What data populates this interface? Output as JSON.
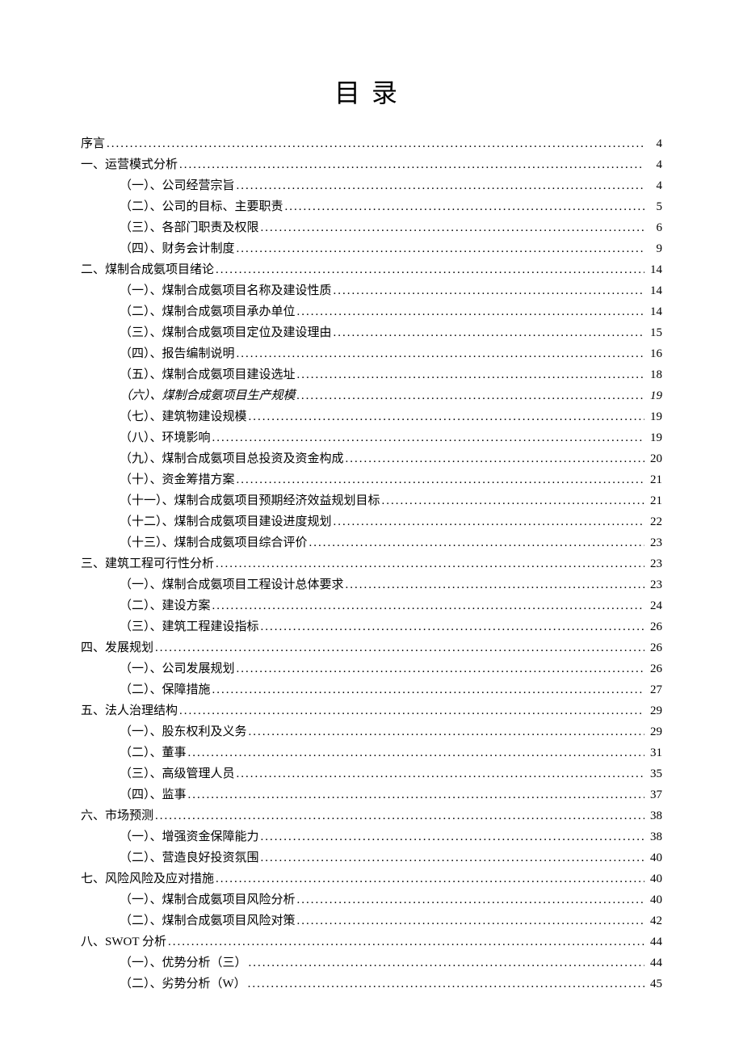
{
  "title": "目录",
  "entries": [
    {
      "level": 0,
      "text": "序言",
      "page": "4",
      "italic": false
    },
    {
      "level": 0,
      "text": "一、运营模式分析",
      "page": "4",
      "italic": false
    },
    {
      "level": 1,
      "text": "（一）、公司经营宗旨",
      "page": "4",
      "italic": false
    },
    {
      "level": 1,
      "text": "（二）、公司的目标、主要职责",
      "page": "5",
      "italic": false
    },
    {
      "level": 1,
      "text": "（三）、各部门职责及权限",
      "page": "6",
      "italic": false
    },
    {
      "level": 1,
      "text": "（四）、财务会计制度",
      "page": "9",
      "italic": false
    },
    {
      "level": 0,
      "text": "二、煤制合成氨项目绪论",
      "page": "14",
      "italic": false
    },
    {
      "level": 1,
      "text": "（一）、煤制合成氨项目名称及建设性质",
      "page": "14",
      "italic": false
    },
    {
      "level": 1,
      "text": "（二）、煤制合成氨项目承办单位",
      "page": "14",
      "italic": false
    },
    {
      "level": 1,
      "text": "（三）、煤制合成氨项目定位及建设理由",
      "page": "15",
      "italic": false
    },
    {
      "level": 1,
      "text": "（四）、报告编制说明",
      "page": "16",
      "italic": false
    },
    {
      "level": 1,
      "text": "（五）、煤制合成氨项目建设选址",
      "page": "18",
      "italic": false
    },
    {
      "level": 1,
      "text": "（六）、煤制合成氨项目生产规模",
      "page": "19",
      "italic": true
    },
    {
      "level": 1,
      "text": "（七）、建筑物建设规模",
      "page": "19",
      "italic": false
    },
    {
      "level": 1,
      "text": "（八）、环境影响",
      "page": "19",
      "italic": false
    },
    {
      "level": 1,
      "text": "（九）、煤制合成氨项目总投资及资金构成",
      "page": "20",
      "italic": false
    },
    {
      "level": 1,
      "text": "（十）、资金筹措方案",
      "page": "21",
      "italic": false
    },
    {
      "level": 1,
      "text": "（十一）、煤制合成氨项目预期经济效益规划目标",
      "page": "21",
      "italic": false
    },
    {
      "level": 1,
      "text": "（十二）、煤制合成氨项目建设进度规划",
      "page": "22",
      "italic": false
    },
    {
      "level": 1,
      "text": "（十三）、煤制合成氨项目综合评价",
      "page": "23",
      "italic": false
    },
    {
      "level": 0,
      "text": "三、建筑工程可行性分析",
      "page": "23",
      "italic": false
    },
    {
      "level": 1,
      "text": "（一）、煤制合成氨项目工程设计总体要求",
      "page": "23",
      "italic": false
    },
    {
      "level": 1,
      "text": "（二）、建设方案",
      "page": "24",
      "italic": false
    },
    {
      "level": 1,
      "text": "（三）、建筑工程建设指标",
      "page": "26",
      "italic": false
    },
    {
      "level": 0,
      "text": "四、发展规划",
      "page": "26",
      "italic": false
    },
    {
      "level": 1,
      "text": "（一）、公司发展规划",
      "page": "26",
      "italic": false
    },
    {
      "level": 1,
      "text": "（二）、保障措施",
      "page": "27",
      "italic": false
    },
    {
      "level": 0,
      "text": "五、法人治理结构",
      "page": "29",
      "italic": false
    },
    {
      "level": 1,
      "text": "（一）、股东权利及义务",
      "page": "29",
      "italic": false
    },
    {
      "level": 1,
      "text": "（二）、董事",
      "page": "31",
      "italic": false
    },
    {
      "level": 1,
      "text": "（三）、高级管理人员",
      "page": "35",
      "italic": false
    },
    {
      "level": 1,
      "text": "（四）、监事",
      "page": "37",
      "italic": false
    },
    {
      "level": 0,
      "text": "六、市场预测",
      "page": "38",
      "italic": false
    },
    {
      "level": 1,
      "text": "（一）、增强资金保障能力",
      "page": "38",
      "italic": false
    },
    {
      "level": 1,
      "text": "（二）、营造良好投资氛围",
      "page": "40",
      "italic": false
    },
    {
      "level": 0,
      "text": "七、风险风险及应对措施",
      "page": "40",
      "italic": false
    },
    {
      "level": 1,
      "text": "（一）、煤制合成氨项目风险分析",
      "page": "40",
      "italic": false
    },
    {
      "level": 1,
      "text": "（二）、煤制合成氨项目风险对策",
      "page": "42",
      "italic": false
    },
    {
      "level": 0,
      "text": "八、SWOT 分析",
      "page": "44",
      "italic": false
    },
    {
      "level": 1,
      "text": "（一）、优势分析（三）",
      "page": "44",
      "italic": false
    },
    {
      "level": 1,
      "text": "（二）、劣势分析（W）",
      "page": "45",
      "italic": false
    }
  ]
}
